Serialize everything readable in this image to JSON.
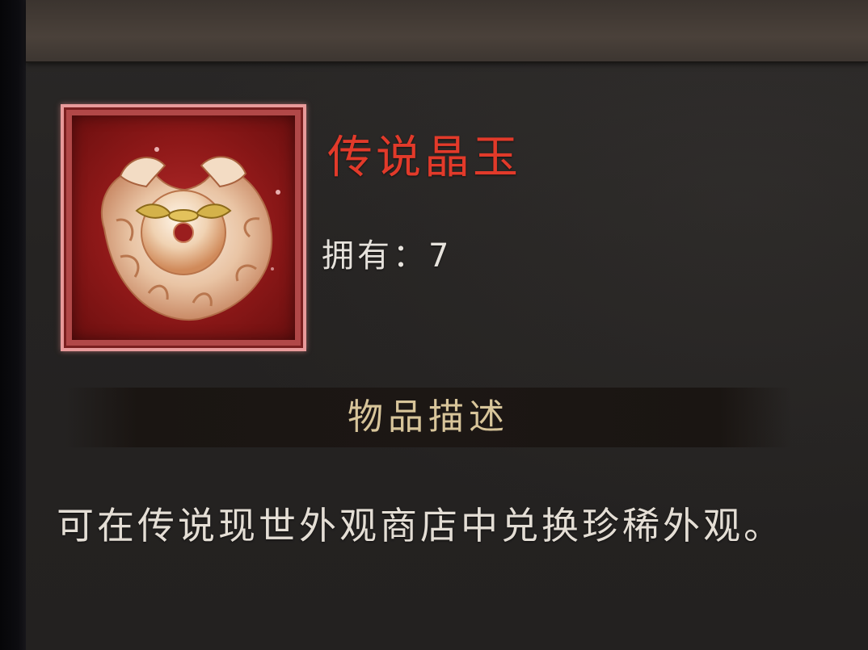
{
  "item": {
    "name": "传说晶玉",
    "owned_text": "拥有：7",
    "name_color": "#e23a2a",
    "rarity_frame_color": "#e89a9a",
    "icon": "jade-dragon-disc-icon"
  },
  "description": {
    "section_title": "物品描述",
    "text": "可在传说现世外观商店中兑换珍稀外观。"
  }
}
